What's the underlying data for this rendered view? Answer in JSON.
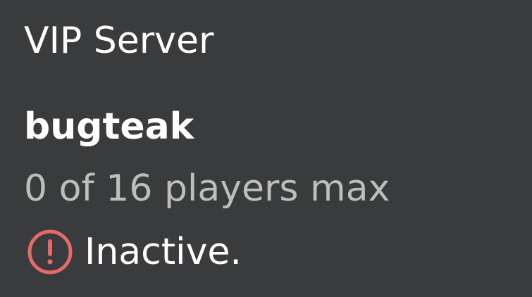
{
  "panel": {
    "title": "VIP Server",
    "server_name": "bugteak",
    "players_text": "0 of 16 players max",
    "status": {
      "icon": "alert-circle-icon",
      "label": "Inactive.",
      "icon_color": "#e66a6a"
    }
  },
  "colors": {
    "background": "#393b3d",
    "primary_text": "#ffffff",
    "secondary_text": "#bdbebe",
    "alert": "#e66a6a"
  }
}
